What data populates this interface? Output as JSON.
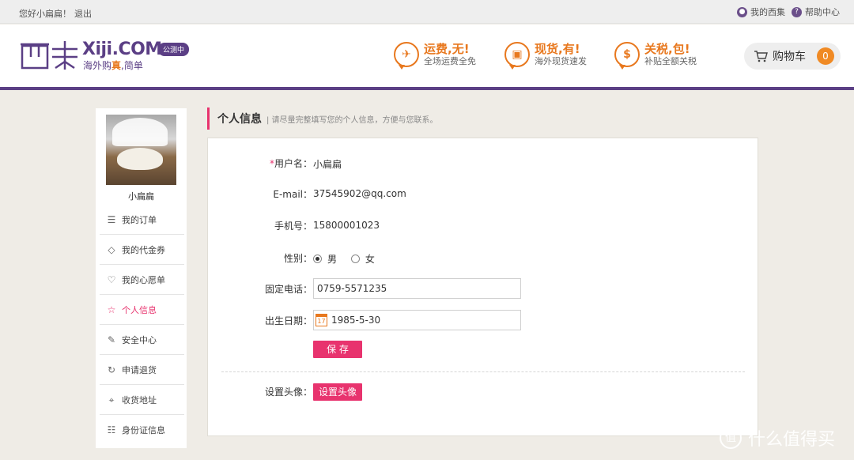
{
  "topbar": {
    "greeting": "您好小扁扁！",
    "logout": "退出",
    "my_xiji": "我的西集",
    "help": "帮助中心"
  },
  "header": {
    "logo_cn": "西集",
    "logo_en": "Xiji.COM",
    "slogan_prefix": "海外购",
    "slogan_emph": "真",
    "slogan_suffix": ",简单",
    "beta_badge": "公测中",
    "promos": [
      {
        "icon": "plane-icon",
        "title": "运费,无!",
        "sub": "全场运费全免"
      },
      {
        "icon": "gift-icon",
        "title": "现货,有!",
        "sub": "海外现货速发"
      },
      {
        "icon": "dollar-icon",
        "title": "关税,包!",
        "sub": "补贴全额关税"
      }
    ],
    "cart_label": "购物车",
    "cart_count": "0"
  },
  "sidebar": {
    "username": "小扁扁",
    "items": [
      {
        "label": "我的订单",
        "icon": "order-icon"
      },
      {
        "label": "我的代金券",
        "icon": "coupon-icon"
      },
      {
        "label": "我的心愿单",
        "icon": "heart-icon"
      },
      {
        "label": "个人信息",
        "icon": "star-icon",
        "active": true
      },
      {
        "label": "安全中心",
        "icon": "edit-icon"
      },
      {
        "label": "申请退货",
        "icon": "refresh-icon"
      },
      {
        "label": "收货地址",
        "icon": "location-icon"
      },
      {
        "label": "身份证信息",
        "icon": "id-card-icon"
      }
    ]
  },
  "section": {
    "title": "个人信息",
    "hint": "| 请尽量完整填写您的个人信息，方便与您联系。"
  },
  "form": {
    "username_label": "用户名：",
    "username_req": "*",
    "username_value": "小扁扁",
    "email_label": "E-mail：",
    "email_value": "37545902@qq.com",
    "phone_label": "手机号：",
    "phone_value": "15800001023",
    "gender_label": "性别：",
    "gender_male": "男",
    "gender_female": "女",
    "gender_selected": "男",
    "landline_label": "固定电话：",
    "landline_value": "0759-5571235",
    "birthday_label": "出生日期：",
    "birthday_value": "1985-5-30",
    "calendar_day": "17",
    "save_button": "保 存",
    "avatar_label": "设置头像：",
    "avatar_button": "设置头像"
  },
  "watermark": {
    "text": "什么值得买",
    "icon_text": "值"
  },
  "colors": {
    "brand_purple": "#5b3f85",
    "accent_pink": "#e8336e",
    "promo_orange": "#e8781e"
  }
}
